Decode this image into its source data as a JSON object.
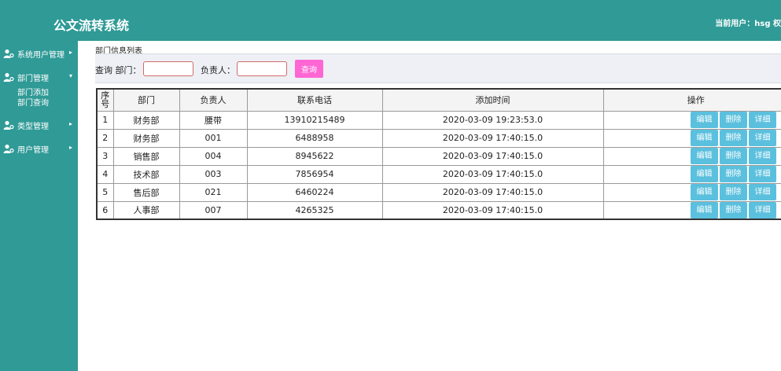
{
  "header": {
    "title": "公文流转系统",
    "user_info": "当前用户：hsg  权"
  },
  "sidebar": {
    "items": [
      {
        "label": "系统用户管理",
        "arrow": "▸"
      },
      {
        "label": "部门管理",
        "arrow": "▾"
      },
      {
        "label": "类型管理",
        "arrow": "▸"
      },
      {
        "label": "用户管理",
        "arrow": "▸"
      }
    ],
    "submenu": [
      {
        "label": "部门添加"
      },
      {
        "label": "部门查询"
      }
    ]
  },
  "main": {
    "breadcrumb": "部门信息列表",
    "query": {
      "label_prefix": "查询 部门：",
      "dept_value": "",
      "owner_label": "负责人：",
      "owner_value": "",
      "button": "查询"
    },
    "table": {
      "headers": {
        "seq_line1": "序",
        "seq_line2": "号",
        "dept": "部门",
        "owner": "负责人",
        "phone": "联系电话",
        "time": "添加时间",
        "ops": "操作"
      },
      "op_labels": {
        "edit": "编辑",
        "delete": "删除",
        "detail": "详细"
      },
      "rows": [
        {
          "seq": "1",
          "dept": "财务部",
          "owner": "腰带",
          "phone": "13910215489",
          "time": "2020-03-09 19:23:53.0"
        },
        {
          "seq": "2",
          "dept": "财务部",
          "owner": "001",
          "phone": "6488958",
          "time": "2020-03-09 17:40:15.0"
        },
        {
          "seq": "3",
          "dept": "销售部",
          "owner": "004",
          "phone": "8945622",
          "time": "2020-03-09 17:40:15.0"
        },
        {
          "seq": "4",
          "dept": "技术部",
          "owner": "003",
          "phone": "7856954",
          "time": "2020-03-09 17:40:15.0"
        },
        {
          "seq": "5",
          "dept": "售后部",
          "owner": "021",
          "phone": "6460224",
          "time": "2020-03-09 17:40:15.0"
        },
        {
          "seq": "6",
          "dept": "人事部",
          "owner": "007",
          "phone": "4265325",
          "time": "2020-03-09 17:40:15.0"
        }
      ]
    }
  },
  "colors": {
    "brand": "#2f9a96",
    "query_button": "#ff66d4",
    "op_button": "#5bc0de"
  }
}
